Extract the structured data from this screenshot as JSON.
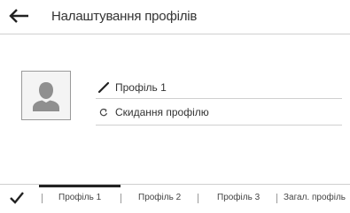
{
  "header": {
    "back_icon": "back-arrow-icon",
    "title": "Налаштування профілів"
  },
  "profile": {
    "avatar_icon": "user-silhouette-icon",
    "name_icon": "pencil-icon",
    "name": "Профіль 1",
    "reset_icon": "reset-icon",
    "reset_label": "Скидання профілю"
  },
  "tabs": {
    "confirm_icon": "checkmark-icon",
    "items": [
      {
        "label": "Профіль 1",
        "selected": true
      },
      {
        "label": "Профіль 2",
        "selected": false
      },
      {
        "label": "Профіль 3",
        "selected": false
      },
      {
        "label": "Загал. профіль",
        "selected": false
      }
    ]
  }
}
